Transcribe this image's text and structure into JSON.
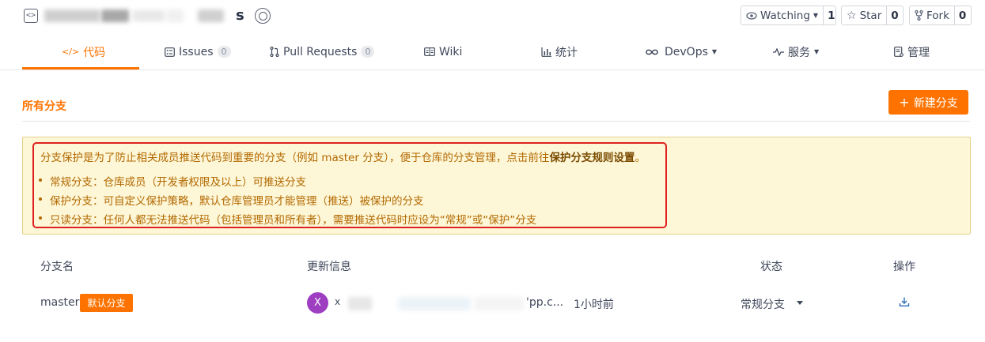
{
  "repo": {
    "icon": "code-bracket-icon",
    "name_suffix": "s"
  },
  "actions": {
    "watch": {
      "label": "Watching",
      "count": "1"
    },
    "star": {
      "label": "Star",
      "count": "0"
    },
    "fork": {
      "label": "Fork",
      "count": "0"
    }
  },
  "tabs": [
    {
      "label": "代码",
      "icon": "code-icon"
    },
    {
      "label": "Issues",
      "icon": "issues-icon",
      "count": "0"
    },
    {
      "label": "Pull Requests",
      "icon": "pull-request-icon",
      "count": "0"
    },
    {
      "label": "Wiki",
      "icon": "wiki-icon"
    },
    {
      "label": "统计",
      "icon": "stats-icon"
    },
    {
      "label": "DevOps",
      "icon": "devops-icon"
    },
    {
      "label": "服务",
      "icon": "service-icon"
    },
    {
      "label": "管理",
      "icon": "manage-icon"
    }
  ],
  "page": {
    "section_title": "所有分支",
    "new_branch_label": "新建分支"
  },
  "notice": {
    "intro": "分支保护是为了防止相关成员推送代码到重要的分支（例如 master 分支），便于仓库的分支管理，点击前往",
    "intro_link": "保护分支规则设置",
    "intro_end": "。",
    "bullets": [
      "常规分支：仓库成员（开发者权限及以上）可推送分支",
      "保护分支：可自定义保护策略，默认仓库管理员才能管理（推送）被保护的分支",
      "只读分支：任何人都无法推送代码（包括管理员和所有者），需要推送代码时应设为“常规”或“保护”分支"
    ]
  },
  "table": {
    "headers": [
      "分支名",
      "更新信息",
      "状态",
      "操作"
    ],
    "rows": [
      {
        "branch": "master",
        "default_badge": "默认分支",
        "avatar_letter": "X",
        "commit_prefix": "x",
        "commit_tail": "'pp.c...",
        "time": "1小时前",
        "status": "常规分支"
      }
    ]
  },
  "colors": {
    "accent": "#fe7300",
    "notice_bg": "#fdf7d7",
    "notice_text": "#b36800",
    "highlight_border": "#e02020",
    "avatar_bg": "#9d3fc0"
  }
}
